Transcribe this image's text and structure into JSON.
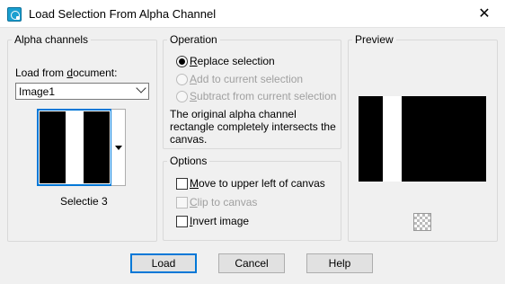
{
  "window": {
    "title": "Load Selection From Alpha Channel",
    "close_glyph": "✕"
  },
  "alpha_channels": {
    "group_label": "Alpha channels",
    "load_from_label_pre": "Load from ",
    "load_from_label_u": "d",
    "load_from_label_post": "ocument:",
    "document_value": "Image1",
    "selected_channel": "Selectie 3"
  },
  "operation": {
    "group_label": "Operation",
    "options": [
      {
        "pre": "",
        "u": "R",
        "post": "eplace selection",
        "checked": true,
        "enabled": true
      },
      {
        "pre": "",
        "u": "A",
        "post": "dd to current selection",
        "checked": false,
        "enabled": false
      },
      {
        "pre": "",
        "u": "S",
        "post": "ubtract from current selection",
        "checked": false,
        "enabled": false
      }
    ],
    "description": "The original alpha channel rectangle completely intersects the canvas."
  },
  "options": {
    "group_label": "Options",
    "move_pre": "",
    "move_u": "M",
    "move_post": "ove to upper left of canvas",
    "clip_pre": "",
    "clip_u": "C",
    "clip_post": "lip to canvas",
    "invert_pre": "",
    "invert_u": "I",
    "invert_post": "nvert image"
  },
  "preview": {
    "group_label": "Preview"
  },
  "buttons": {
    "load": "Load",
    "cancel": "Cancel",
    "help": "Help"
  },
  "colors": {
    "accent": "#0078d7",
    "app_icon": "#1a9fd0"
  },
  "icons": {
    "app": "paint-shop-app-icon",
    "zoom": "checkerboard-zoom-icon",
    "close": "close-icon"
  }
}
